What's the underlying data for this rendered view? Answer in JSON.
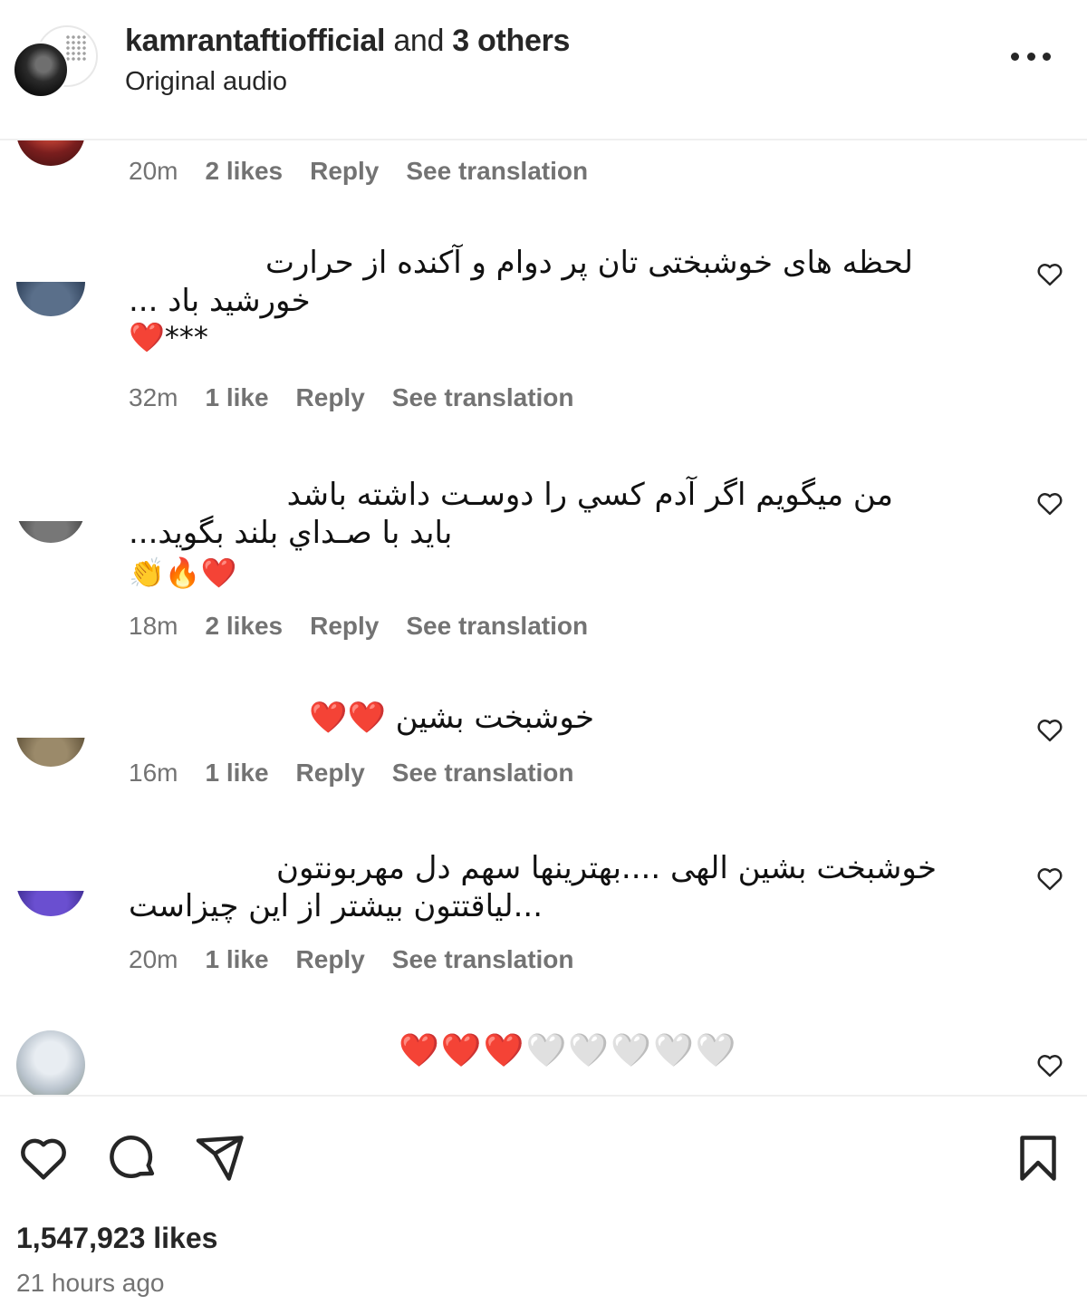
{
  "header": {
    "username": "kamrantaftiofficial",
    "connector": "and",
    "others": "3 others",
    "audio": "Original audio",
    "menu_icon": "more-horizontal-icon"
  },
  "comments": [
    {
      "time": "20m",
      "likes": "2 likes",
      "reply": "Reply",
      "translate": "See translation"
    },
    {
      "lines": [
        "لحظه های خوشبختی تان پر دوام و آکنده از حرارت",
        "خورشید باد ..."
      ],
      "emoji": "❤️***",
      "time": "32m",
      "likes": "1 like",
      "reply": "Reply",
      "translate": "See translation"
    },
    {
      "lines": [
        "من ميگويم اگر آدم كسي را دوسـت داشته باشد",
        "بايد با صـداي بلند بگويد..."
      ],
      "emoji": "👏🔥❤️",
      "time": "18m",
      "likes": "2 likes",
      "reply": "Reply",
      "translate": "See translation"
    },
    {
      "lines": [
        "خوشبخت بشین ❤️❤️"
      ],
      "time": "16m",
      "likes": "1 like",
      "reply": "Reply",
      "translate": "See translation"
    },
    {
      "lines": [
        "خوشبخت بشین الهی ....بهترینها سهم دل مهربونتون",
        "...لیاقتتون بیشتر از این چیزاست"
      ],
      "time": "20m",
      "likes": "1 like",
      "reply": "Reply",
      "translate": "See translation"
    },
    {
      "lines": [
        "❤️❤️❤️🤍🤍🤍🤍🤍"
      ]
    }
  ],
  "actions": {
    "like_icon": "heart-icon",
    "comment_icon": "comment-icon",
    "share_icon": "send-icon",
    "save_icon": "bookmark-icon"
  },
  "post": {
    "likes": "1,547,923 likes",
    "time_ago": "21 hours ago"
  }
}
